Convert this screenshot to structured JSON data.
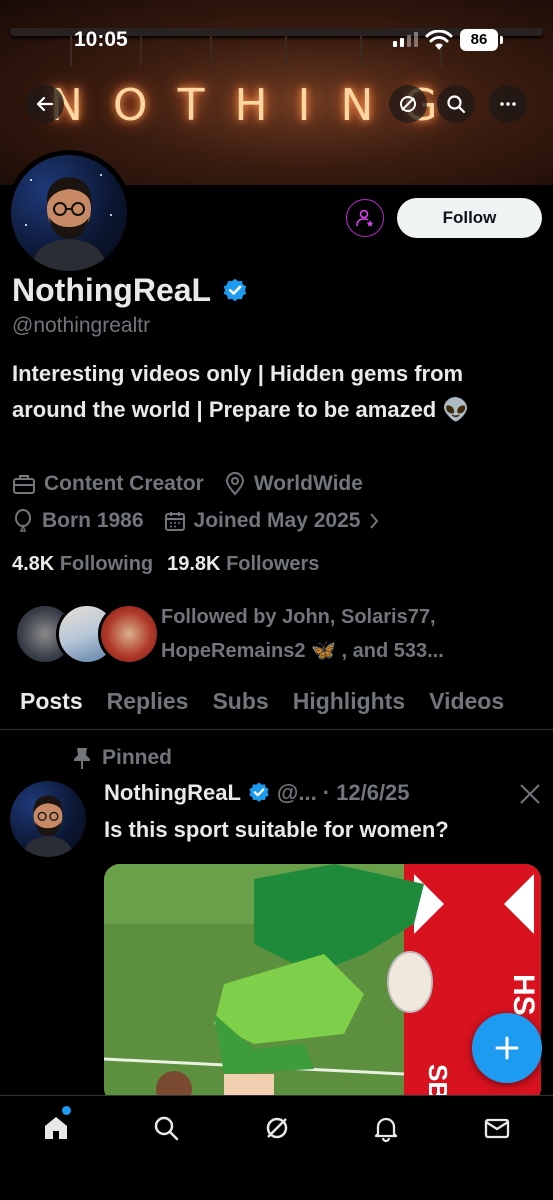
{
  "status_bar": {
    "time": "10:05",
    "battery": "86"
  },
  "banner": {
    "letters": [
      "N",
      "O",
      "T",
      "H",
      "I",
      "N",
      "G"
    ]
  },
  "profile": {
    "follow_label": "Follow",
    "name": "NothingReaL",
    "handle": "@nothingrealtr",
    "bio": "Interesting videos only | Hidden gems from around the world | Prepare to be amazed 👽",
    "category": "Content Creator",
    "location": "WorldWide",
    "born": "Born 1986",
    "joined": "Joined May 2025",
    "following_count": "4.8K",
    "following_label": "Following",
    "followers_count": "19.8K",
    "followers_label": "Followers",
    "followed_by_line1": "Followed by John, Solaris77,",
    "followed_by_line2": "HopeRemains2 🦋 , and 533..."
  },
  "tabs": [
    "Posts",
    "Replies",
    "Subs",
    "Highlights",
    "Videos"
  ],
  "post": {
    "pinned_label": "Pinned",
    "author": "NothingReaL",
    "handle_short": "@...",
    "date": "· 12/6/25",
    "text": "Is this sport suitable for women?",
    "media_text": "SBC",
    "media_text_2": "HS"
  },
  "colors": {
    "accent": "#1d9bf0",
    "background": "#000000",
    "muted": "#71767b",
    "text": "#e7e9ea"
  },
  "icons": [
    "back-arrow-icon",
    "grok-icon",
    "search-icon",
    "more-icon",
    "subscribe-icon",
    "verified-icon",
    "briefcase-icon",
    "location-icon",
    "balloon-icon",
    "calendar-icon",
    "pin-icon",
    "x-logo-icon",
    "plus-icon",
    "home-icon",
    "search-nav-icon",
    "grok-nav-icon",
    "bell-icon",
    "mail-icon"
  ]
}
